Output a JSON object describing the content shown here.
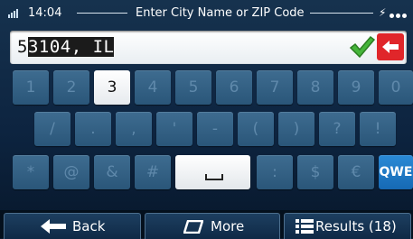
{
  "status_bar": {
    "time": "14:04",
    "title": "Enter City Name or ZIP Code",
    "icons": [
      "signal-icon",
      "gps-icon",
      "more-dots-icon"
    ]
  },
  "input": {
    "value_prefix": "5",
    "value_selected": "3104, IL",
    "confirm_icon": "checkmark-icon",
    "delete_icon": "backspace-arrow-icon"
  },
  "keyboard": {
    "row1": [
      "1",
      "2",
      "3",
      "4",
      "5",
      "6",
      "7",
      "8",
      "9",
      "0"
    ],
    "row2": [
      "/",
      ".",
      ",",
      "'",
      "-",
      "(",
      ")",
      "?",
      "!"
    ],
    "row3_left": [
      "*",
      "@",
      "&",
      "#"
    ],
    "space_icon": "space-bar-icon",
    "row3_right": [
      ":",
      "$",
      "€"
    ],
    "layout_switch": "QWE",
    "active_key": "3"
  },
  "bottom_bar": {
    "back_label": "Back",
    "more_label": "More",
    "results_label": "Results (18)"
  },
  "colors": {
    "key_bg": "#2f5b80",
    "key_active_bg": "#ffffff",
    "accent_blue": "#1b78c8",
    "delete_red": "#e0262a",
    "check_green": "#3aa12a"
  }
}
